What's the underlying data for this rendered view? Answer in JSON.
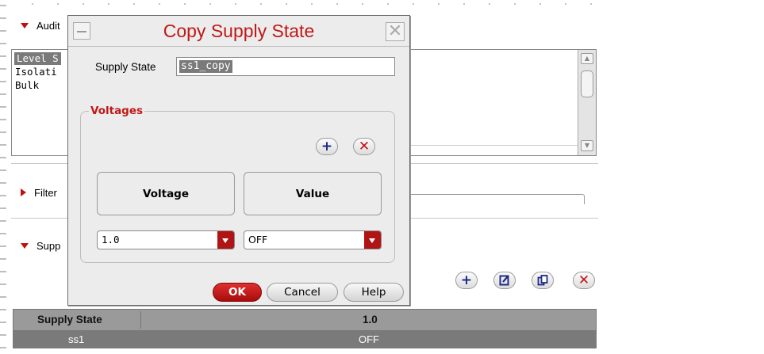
{
  "background": {
    "sections": {
      "audit_label": "Audit",
      "filter_label": "Filter",
      "supply_label": "Supp"
    },
    "list_items": [
      "Level S",
      "Isolati",
      "Bulk"
    ],
    "table": {
      "headers": [
        "Supply State",
        "1.0"
      ],
      "rows": [
        [
          "ss1",
          "OFF"
        ]
      ]
    },
    "icons": [
      "add-icon",
      "edit-icon",
      "copy-icon",
      "delete-icon"
    ]
  },
  "dialog": {
    "title": "Copy Supply State",
    "supply_state_label": "Supply State",
    "supply_state_value": "ss1_copy",
    "voltages_group_title": "Voltages",
    "columns": [
      "Voltage",
      "Value"
    ],
    "voltage_value": "1.0",
    "value_value": "OFF",
    "buttons": {
      "ok": "OK",
      "cancel": "Cancel",
      "help": "Help"
    },
    "glyphs": {
      "add": "+",
      "delete": "✕",
      "close": "✕"
    }
  },
  "colors": {
    "accent_red": "#c01818",
    "icon_blue": "#1b2a86",
    "selection_gray": "#7a7a7a"
  }
}
